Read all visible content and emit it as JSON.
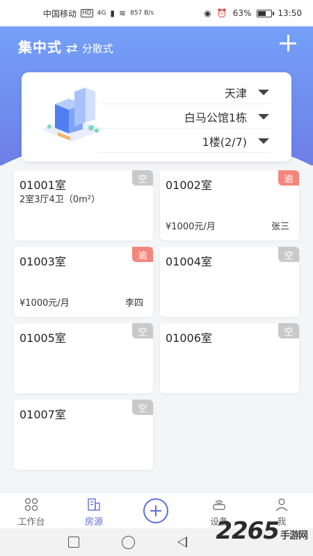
{
  "status_bar": {
    "carrier": "中国移动",
    "hd": "HD",
    "network": "4G",
    "speed": "857 B/s",
    "battery": "63%",
    "battery_level": 0.63,
    "time": "13:50"
  },
  "header": {
    "mode_current": "集中式",
    "mode_alt": "分散式",
    "swap_icon": "swap-icon",
    "add_icon": "plus-icon"
  },
  "selector": {
    "city": "天津",
    "building": "白马公馆1栋",
    "floor": "1楼(2/7)"
  },
  "rooms": [
    {
      "number": "01001室",
      "layout": "2室3厅4卫（0m²）",
      "rent": "",
      "tenant": "",
      "badge": "空",
      "badge_type": "empty"
    },
    {
      "number": "01002室",
      "layout": "",
      "rent": "¥1000元/月",
      "tenant": "张三",
      "badge": "逾",
      "badge_type": "overdue"
    },
    {
      "number": "01003室",
      "layout": "",
      "rent": "¥1000元/月",
      "tenant": "李四",
      "badge": "逾",
      "badge_type": "overdue"
    },
    {
      "number": "01004室",
      "layout": "",
      "rent": "",
      "tenant": "",
      "badge": "空",
      "badge_type": "empty"
    },
    {
      "number": "01005室",
      "layout": "",
      "rent": "",
      "tenant": "",
      "badge": "空",
      "badge_type": "empty"
    },
    {
      "number": "01006室",
      "layout": "",
      "rent": "",
      "tenant": "",
      "badge": "空",
      "badge_type": "empty"
    },
    {
      "number": "01007室",
      "layout": "",
      "rent": "",
      "tenant": "",
      "badge": "空",
      "badge_type": "empty"
    }
  ],
  "tabbar": {
    "tabs": [
      {
        "label": "工作台",
        "icon": "grid-icon"
      },
      {
        "label": "房源",
        "icon": "building-icon"
      },
      {
        "label": "设备",
        "icon": "router-icon"
      },
      {
        "label": "我",
        "icon": "user-icon"
      }
    ],
    "active_color": "#5b6fd8"
  },
  "watermark": {
    "brand": "2265",
    "sub": "手游网"
  },
  "colors": {
    "header_top": "#74a0f7",
    "header_bottom": "#6d7fe8",
    "badge_empty": "#c9c9c9",
    "badge_overdue": "#f4877d"
  }
}
